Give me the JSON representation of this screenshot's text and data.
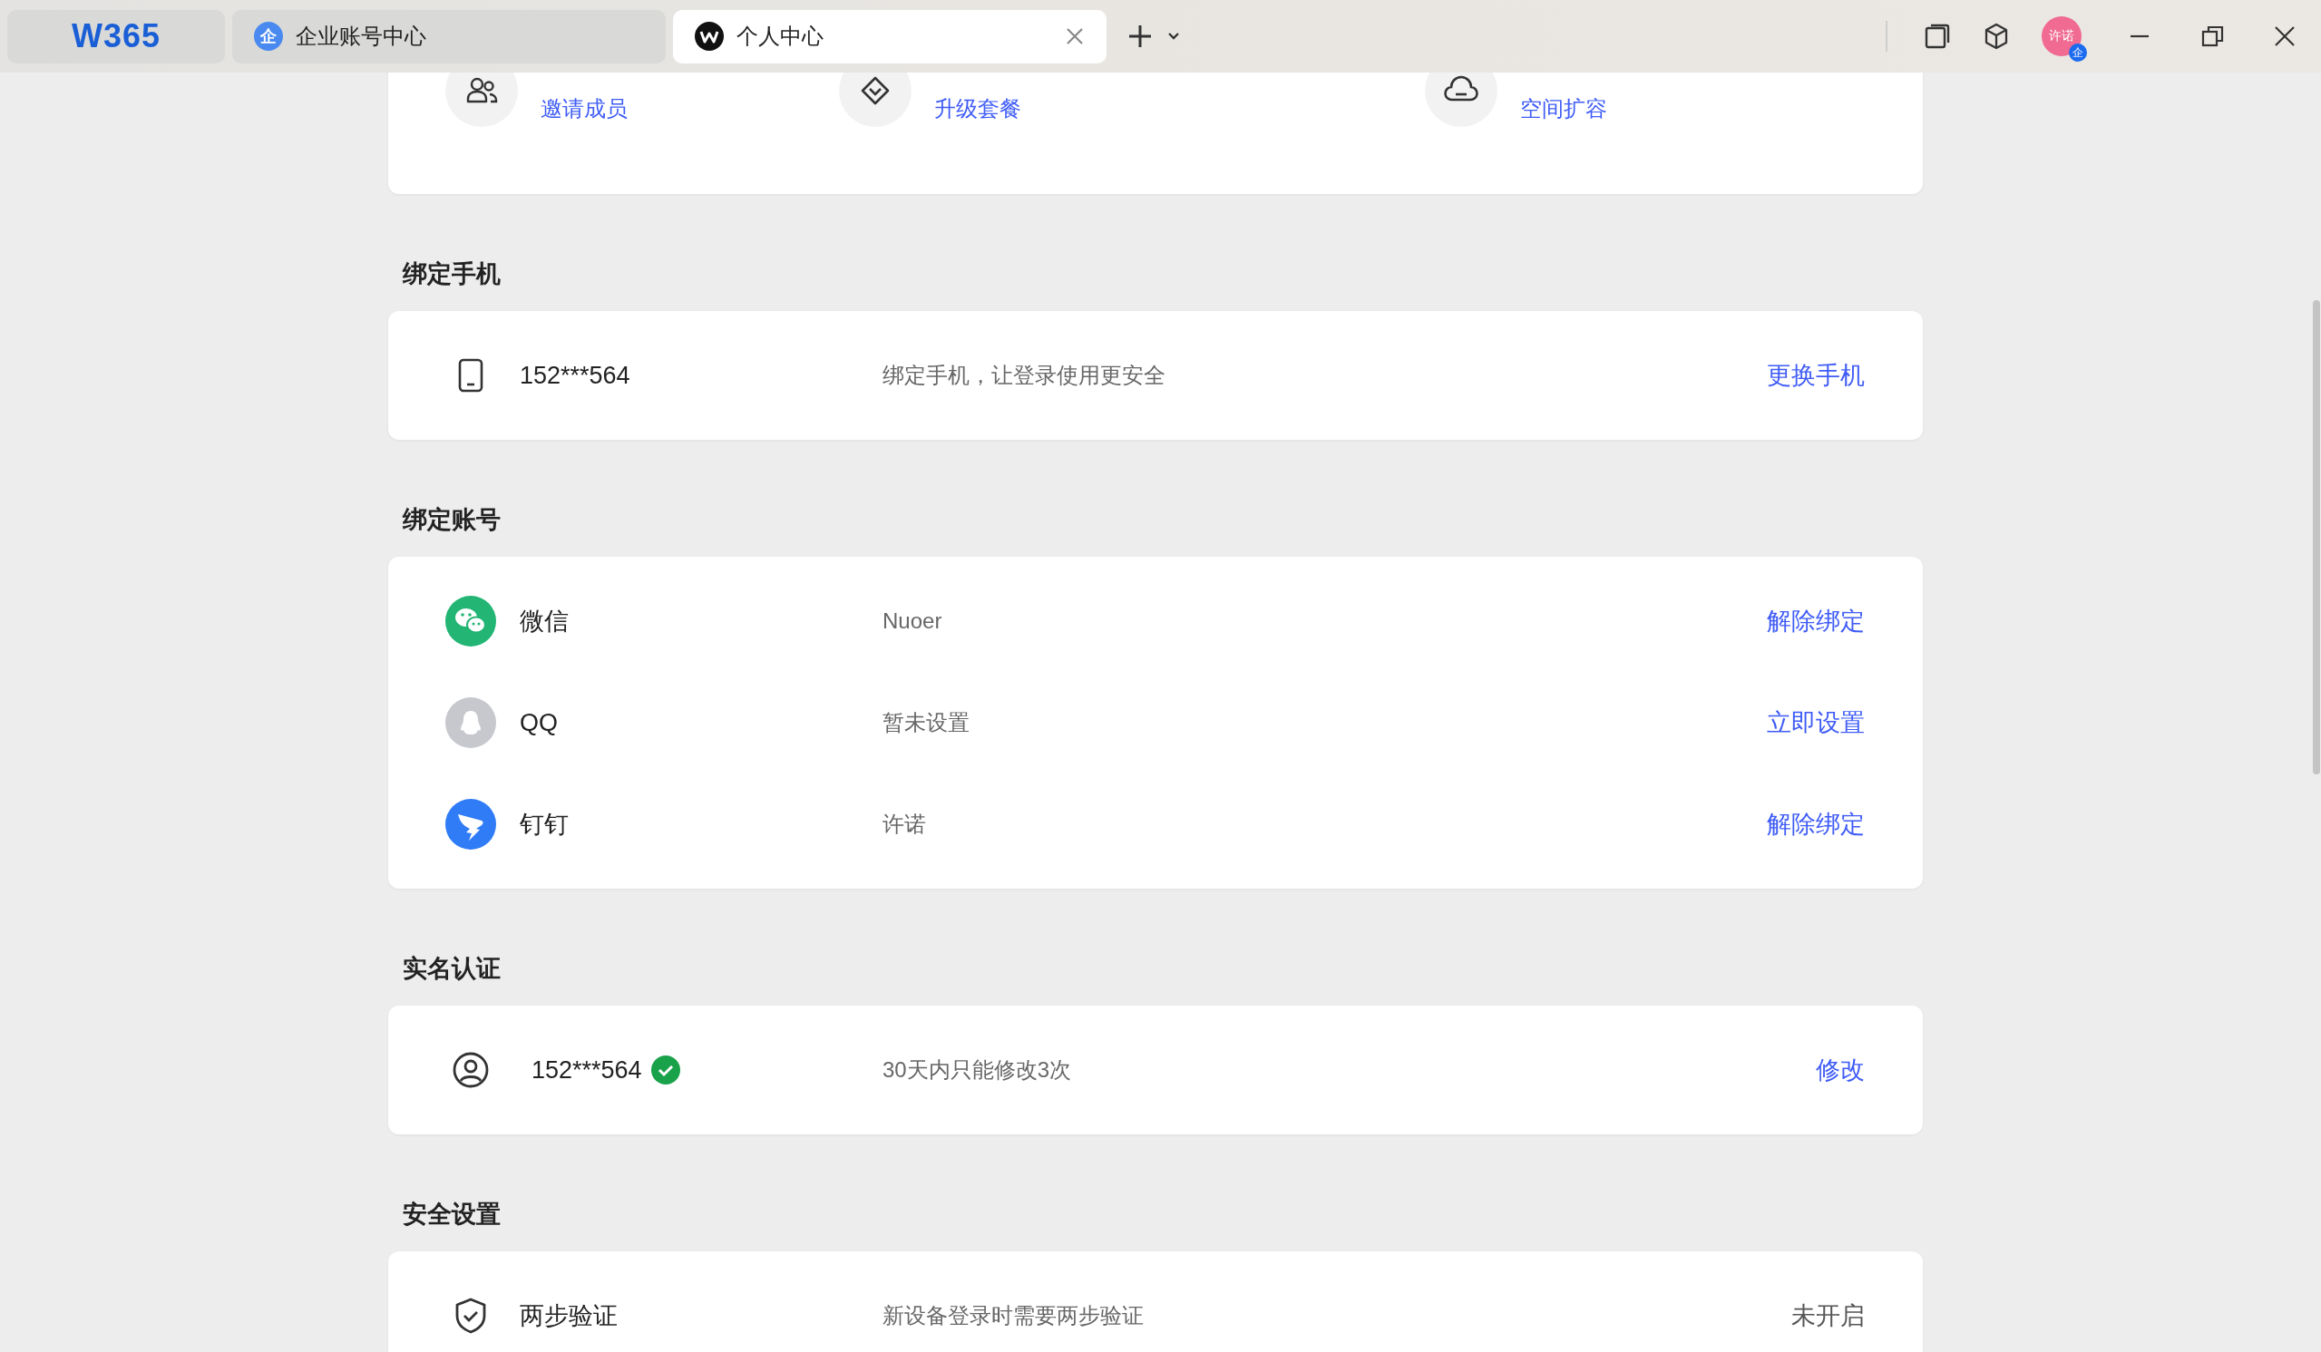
{
  "tabs": [
    {
      "kind": "logo",
      "label": "W365",
      "selected": false
    },
    {
      "kind": "company",
      "icon_text": "企",
      "label": "企业账号中心",
      "selected": false
    },
    {
      "kind": "personal",
      "label": "个人中心",
      "selected": true
    }
  ],
  "account": {
    "avatar_text": "许诺",
    "badge": "企"
  },
  "overview": [
    {
      "kind": "members",
      "link": "邀请成员"
    },
    {
      "kind": "plan",
      "link": "升级套餐"
    },
    {
      "kind": "storage",
      "link": "空间扩容"
    }
  ],
  "sections": [
    {
      "title": "绑定手机",
      "rows": [
        {
          "kind": "phone",
          "name": "152***564",
          "verified": false,
          "description": "绑定手机，让登录使用更安全",
          "action": "更换手机"
        }
      ]
    },
    {
      "title": "绑定账号",
      "rows": [
        {
          "kind": "wechat",
          "name": "微信",
          "verified": false,
          "description": "Nuoer",
          "action": "解除绑定"
        },
        {
          "kind": "qq",
          "name": "QQ",
          "verified": false,
          "description": "暂未设置",
          "action": "立即设置"
        },
        {
          "kind": "dingtalk",
          "name": "钉钉",
          "verified": false,
          "description": "许诺",
          "action": "解除绑定"
        }
      ]
    },
    {
      "title": "实名认证",
      "rows": [
        {
          "kind": "person",
          "name": "152***564",
          "verified": true,
          "description": "30天内只能修改3次",
          "action": "修改"
        }
      ]
    },
    {
      "title": "安全设置",
      "rows": [
        {
          "kind": "shield",
          "name": "两步验证",
          "verified": false,
          "description": "新设备登录时需要两步验证",
          "status": "未开启"
        }
      ]
    }
  ]
}
